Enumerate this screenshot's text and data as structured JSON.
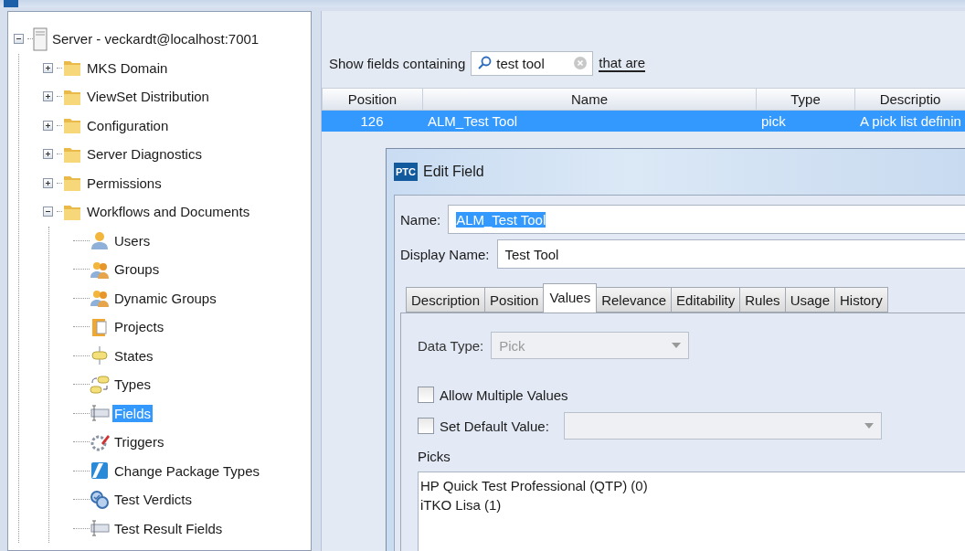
{
  "tree": {
    "label": "Server - veckardt@localhost:7001",
    "kind": "server",
    "expanded": true,
    "selected": false,
    "children": [
      {
        "label": "MKS Domain",
        "kind": "folder",
        "expanded": false,
        "selected": false
      },
      {
        "label": "ViewSet Distribution",
        "kind": "folder",
        "expanded": false,
        "selected": false
      },
      {
        "label": "Configuration",
        "kind": "folder",
        "expanded": false,
        "selected": false
      },
      {
        "label": "Server Diagnostics",
        "kind": "folder",
        "expanded": false,
        "selected": false
      },
      {
        "label": "Permissions",
        "kind": "folder",
        "expanded": false,
        "selected": false
      },
      {
        "label": "Workflows and Documents",
        "kind": "folder",
        "expanded": true,
        "selected": false,
        "children": [
          {
            "label": "Users",
            "kind": "user",
            "selected": false
          },
          {
            "label": "Groups",
            "kind": "group",
            "selected": false
          },
          {
            "label": "Dynamic Groups",
            "kind": "group",
            "selected": false
          },
          {
            "label": "Projects",
            "kind": "project",
            "selected": false
          },
          {
            "label": "States",
            "kind": "state",
            "selected": false
          },
          {
            "label": "Types",
            "kind": "type",
            "selected": false
          },
          {
            "label": "Fields",
            "kind": "field",
            "selected": true
          },
          {
            "label": "Triggers",
            "kind": "trigger",
            "selected": false
          },
          {
            "label": "Change Package Types",
            "kind": "package",
            "selected": false
          },
          {
            "label": "Test Verdicts",
            "kind": "verdict",
            "selected": false
          },
          {
            "label": "Test Result Fields",
            "kind": "field",
            "selected": false
          }
        ]
      }
    ]
  },
  "filter": {
    "label": "Show fields containing",
    "value": "test tool",
    "qualifier": "that are"
  },
  "table": {
    "columns": [
      "Position",
      "Name",
      "Type",
      "Descriptio"
    ],
    "rows": [
      {
        "cells": [
          "126",
          "ALM_Test Tool",
          "pick",
          "A pick list definin"
        ],
        "selected": true
      }
    ]
  },
  "dialog": {
    "logo": "PTC",
    "title": "Edit Field",
    "name": {
      "label": "Name:",
      "value": "ALM_Test Tool"
    },
    "display_name": {
      "label": "Display Name:",
      "value": "Test Tool"
    },
    "tabs": [
      {
        "label": "Description",
        "selected": false
      },
      {
        "label": "Position",
        "selected": false
      },
      {
        "label": "Values",
        "selected": true
      },
      {
        "label": "Relevance",
        "selected": false
      },
      {
        "label": "Editability",
        "selected": false
      },
      {
        "label": "Rules",
        "selected": false
      },
      {
        "label": "Usage",
        "selected": false
      },
      {
        "label": "History",
        "selected": false
      }
    ],
    "data_type": {
      "label": "Data Type:",
      "value": "Pick",
      "disabled": true
    },
    "allow_multiple": {
      "label": "Allow Multiple Values",
      "checked": false
    },
    "default_value": {
      "label": "Set Default Value:",
      "checked": false,
      "disabled": true
    },
    "picks": {
      "label": "Picks",
      "items": [
        "HP Quick Test Professional (QTP) (0)",
        "iTKO Lisa (1)"
      ]
    }
  }
}
